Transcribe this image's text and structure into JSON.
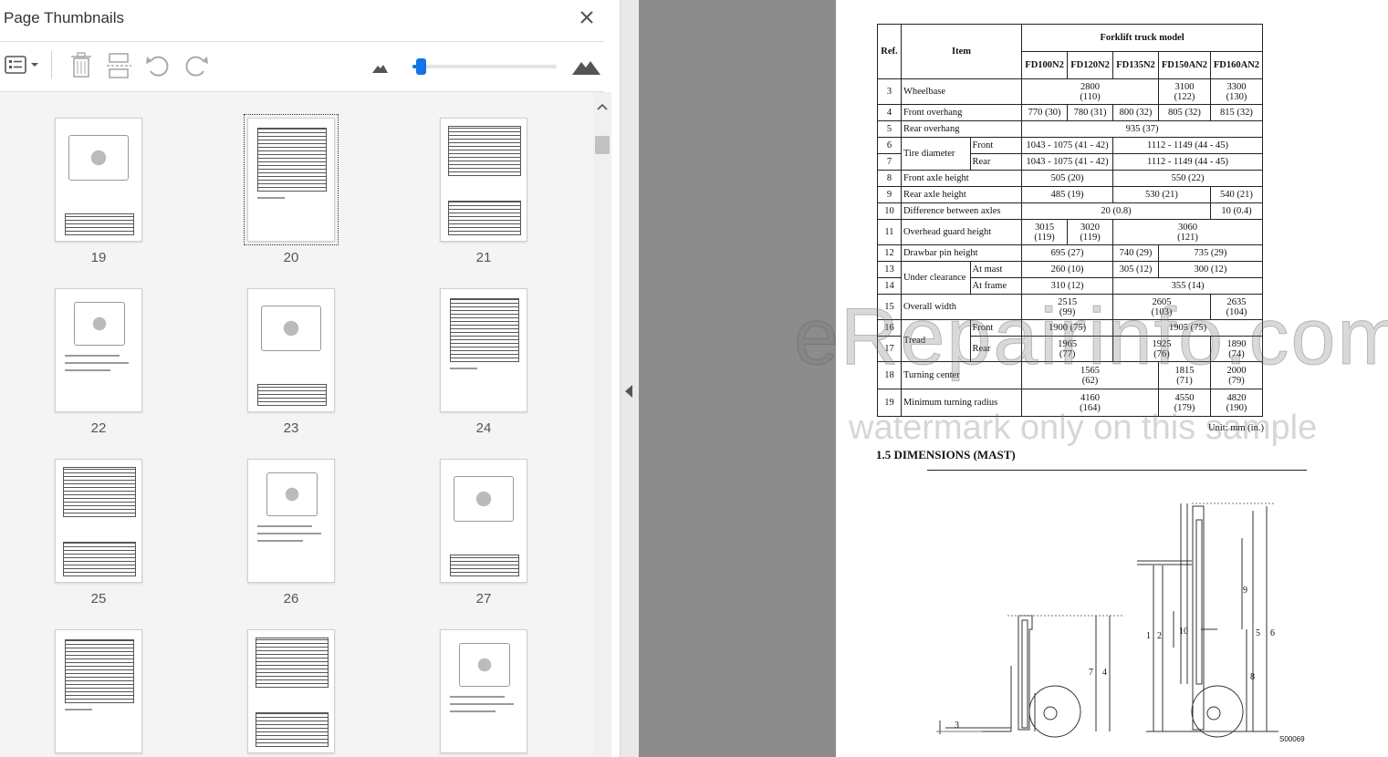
{
  "panel": {
    "title": "Page Thumbnails",
    "zoom_level": 0.04
  },
  "thumbnails": [
    {
      "page": "19",
      "selected": false
    },
    {
      "page": "20",
      "selected": true
    },
    {
      "page": "21",
      "selected": false
    },
    {
      "page": "22",
      "selected": false
    },
    {
      "page": "23",
      "selected": false
    },
    {
      "page": "24",
      "selected": false
    },
    {
      "page": "25",
      "selected": false
    },
    {
      "page": "26",
      "selected": false
    },
    {
      "page": "27",
      "selected": false
    },
    {
      "page": "",
      "selected": false
    },
    {
      "page": "",
      "selected": false
    },
    {
      "page": "",
      "selected": false
    }
  ],
  "colors": {
    "accent": "#1473e6",
    "gutter": "#8c8c8c",
    "thumb_bg": "#f4f4f4"
  },
  "document": {
    "table_header": {
      "ref": "Ref.",
      "item": "Item",
      "group": "Forklift truck model",
      "models": [
        "FD100N2",
        "FD120N2",
        "FD135N2",
        "FD150AN2",
        "FD160AN2"
      ]
    },
    "rows": {
      "r3": {
        "ref": "3",
        "item": "Wheelbase",
        "v1": "2800\n(110)",
        "v2": "3100\n(122)",
        "v3": "3300\n(130)"
      },
      "r4": {
        "ref": "4",
        "item": "Front overhang",
        "v1": "770 (30)",
        "v2": "780 (31)",
        "v3": "800 (32)",
        "v4": "805 (32)",
        "v5": "815 (32)"
      },
      "r5": {
        "ref": "5",
        "item": "Rear overhang",
        "v1": "935 (37)"
      },
      "r6": {
        "ref": "6",
        "item": "Tire diameter",
        "sub": "Front",
        "v1": "1043 - 1075 (41 - 42)",
        "v2": "1112 - 1149 (44 - 45)"
      },
      "r7": {
        "ref": "7",
        "sub": "Rear",
        "v1": "1043 - 1075 (41 - 42)",
        "v2": "1112 - 1149 (44 - 45)"
      },
      "r8": {
        "ref": "8",
        "item": "Front axle height",
        "v1": "505 (20)",
        "v2": "550 (22)"
      },
      "r9": {
        "ref": "9",
        "item": "Rear axle height",
        "v1": "485 (19)",
        "v2": "530 (21)",
        "v3": "540 (21)"
      },
      "r10": {
        "ref": "10",
        "item": "Difference between axles",
        "v1": "20 (0.8)",
        "v2": "10 (0.4)"
      },
      "r11": {
        "ref": "11",
        "item": "Overhead guard height",
        "v1": "3015\n(119)",
        "v2": "3020\n(119)",
        "v3": "3060\n(121)"
      },
      "r12": {
        "ref": "12",
        "item": "Drawbar pin height",
        "v1": "695 (27)",
        "v2": "740 (29)",
        "v3": "735 (29)"
      },
      "r13": {
        "ref": "13",
        "item": "Under clearance",
        "sub": "At mast",
        "v1": "260 (10)",
        "v2": "305 (12)",
        "v3": "300 (12)"
      },
      "r14": {
        "ref": "14",
        "sub": "At frame",
        "v1": "310 (12)",
        "v2": "355 (14)"
      },
      "r15": {
        "ref": "15",
        "item": "Overall width",
        "v1": "2515\n(99)",
        "v2": "2605\n(103)",
        "v3": "2635\n(104)"
      },
      "r16": {
        "ref": "16",
        "item": "Tread",
        "sub": "Front",
        "v1": "1900 (75)",
        "v2": "1905 (75)"
      },
      "r17": {
        "ref": "17",
        "sub": "Rear",
        "v1": "1965\n(77)",
        "v2": "1925\n(76)",
        "v3": "1890\n(74)"
      },
      "r18": {
        "ref": "18",
        "item": "Turning center",
        "v1": "1565\n(62)",
        "v2": "1815\n(71)",
        "v3": "2000\n(79)"
      },
      "r19": {
        "ref": "19",
        "item": "Minimum turning radius",
        "v1": "4160\n(164)",
        "v2": "4550\n(179)",
        "v3": "4820\n(190)"
      }
    },
    "unit_note": "Unit: mm (in.)",
    "section_title": "1.5 DIMENSIONS (MAST)",
    "drawing_labels": [
      "3",
      "7",
      "4",
      "1",
      "2",
      "10",
      "9",
      "5",
      "6",
      "8"
    ],
    "drawing_code": "S00069"
  },
  "watermark": {
    "brand": "eRepairinfo.com",
    "note": "watermark only on this sample"
  }
}
